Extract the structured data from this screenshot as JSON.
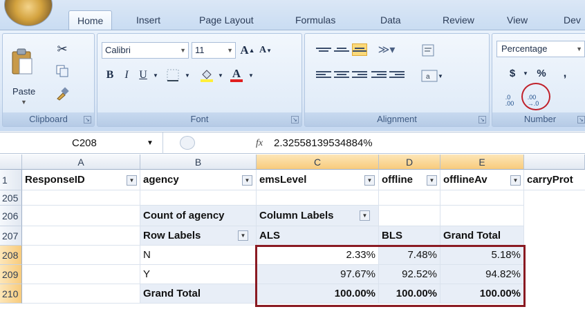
{
  "ribbon": {
    "tabs": [
      "Home",
      "Insert",
      "Page Layout",
      "Formulas",
      "Data",
      "Review",
      "View",
      "Dev"
    ],
    "groups": {
      "clipboard": {
        "label": "Clipboard",
        "paste_label": "Paste"
      },
      "font": {
        "label": "Font",
        "font_name": "Calibri",
        "font_size": "11"
      },
      "alignment": {
        "label": "Alignment"
      },
      "number": {
        "label": "Number",
        "format": "Percentage",
        "currency_symbol": "$",
        "percent_symbol": "%",
        "comma_symbol": ",",
        "increase_decimal": ".0\n.00",
        "decrease_decimal": ".00\n→.0"
      }
    }
  },
  "formula_bar": {
    "cell_ref": "C208",
    "fx": "fx",
    "value": "2.32558139534884%"
  },
  "grid": {
    "columns": [
      "A",
      "B",
      "C",
      "D",
      "E"
    ],
    "header_row": {
      "row": "1",
      "cells": [
        "ResponseID",
        "agency",
        "emsLevel",
        "offline",
        "offlineAv",
        "carryProt"
      ]
    },
    "rows": [
      {
        "row": "205",
        "cells": [
          "",
          "",
          "",
          "",
          ""
        ]
      },
      {
        "row": "206",
        "cells": [
          "",
          "Count of agency",
          "Column Labels",
          "",
          ""
        ]
      },
      {
        "row": "207",
        "cells": [
          "",
          "Row Labels",
          "ALS",
          "BLS",
          "Grand Total"
        ]
      },
      {
        "row": "208",
        "cells": [
          "",
          "N",
          "2.33%",
          "7.48%",
          "5.18%"
        ]
      },
      {
        "row": "209",
        "cells": [
          "",
          "Y",
          "97.67%",
          "92.52%",
          "94.82%"
        ]
      },
      {
        "row": "210",
        "cells": [
          "",
          "Grand Total",
          "100.00%",
          "100.00%",
          "100.00%"
        ]
      }
    ]
  }
}
